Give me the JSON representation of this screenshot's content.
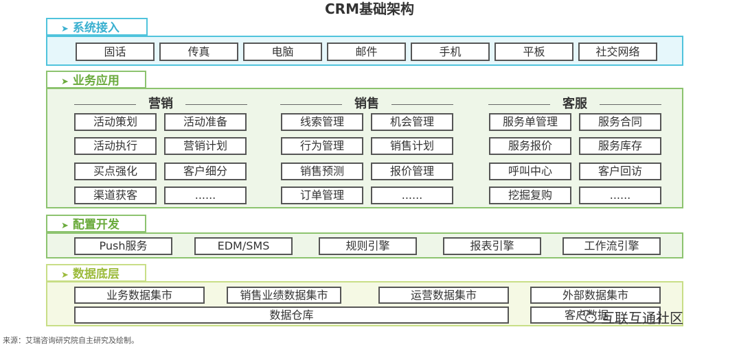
{
  "title": "CRM基础架构",
  "sections": {
    "access": {
      "label": "系统接入",
      "items": [
        "固话",
        "传真",
        "电脑",
        "邮件",
        "手机",
        "平板",
        "社交网络"
      ]
    },
    "apps": {
      "label": "业务应用",
      "groups": [
        {
          "name": "营销",
          "items": [
            "活动策划",
            "活动准备",
            "活动执行",
            "营销计划",
            "买点强化",
            "客户细分",
            "渠道获客",
            "......"
          ]
        },
        {
          "name": "销售",
          "items": [
            "线索管理",
            "机会管理",
            "行为管理",
            "销售计划",
            "销售预测",
            "报价管理",
            "订单管理",
            "......"
          ]
        },
        {
          "name": "客服",
          "items": [
            "服务单管理",
            "服务合同",
            "服务报价",
            "服务库存",
            "呼叫中心",
            "客户回访",
            "挖掘复购",
            "......"
          ]
        }
      ]
    },
    "config": {
      "label": "配置开发",
      "items": [
        "Push服务",
        "EDM/SMS",
        "规则引擎",
        "报表引擎",
        "工作流引擎"
      ]
    },
    "data": {
      "label": "数据底层",
      "items": [
        "业务数据集市",
        "销售业绩数据集市",
        "运营数据集市",
        "外部数据集市",
        "数据仓库",
        "客户数据"
      ]
    }
  },
  "source": "来源：艾瑞咨询研究院自主研究及绘制。",
  "watermark": "互联互通社区",
  "colors": {
    "blue_border": "#4fc3dc",
    "blue_fill": "#e6f7fb",
    "blue_text": "#3ab0d0",
    "green_border": "#8cc36e",
    "green_fill": "#eef6e8",
    "green_text": "#6aaa3c",
    "yellow_border": "#c8de86",
    "yellow_fill": "#f5f9e4",
    "yellow_text": "#9cbb3c"
  },
  "icons": {
    "tab_marker": "arrow-right-icon",
    "watermark_logo": "wechat-icon"
  }
}
